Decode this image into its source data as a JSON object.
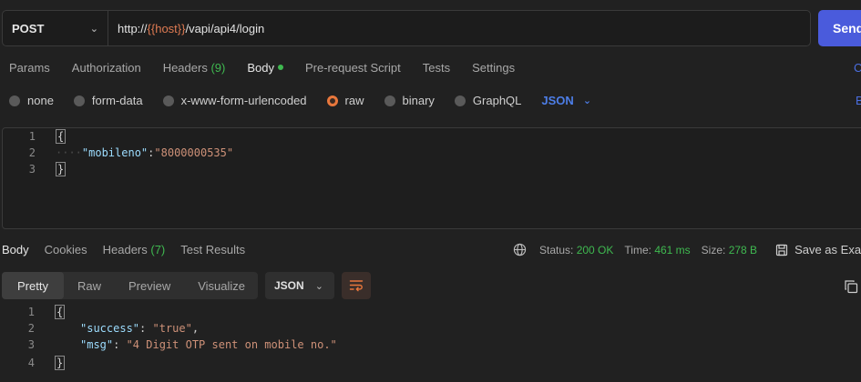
{
  "request": {
    "method": "POST",
    "url_prefix": "http://",
    "url_var": "{{host}}",
    "url_suffix": "/vapi/api4/login",
    "send_label": "Send"
  },
  "req_tabs": {
    "params": "Params",
    "authorization": "Authorization",
    "headers": "Headers",
    "headers_count": "(9)",
    "body": "Body",
    "prerequest": "Pre-request Script",
    "tests": "Tests",
    "settings": "Settings",
    "edge_c": "C",
    "edge_b": "B"
  },
  "body_types": {
    "none": "none",
    "form_data": "form-data",
    "urlencoded": "x-www-form-urlencoded",
    "raw": "raw",
    "binary": "binary",
    "graphql": "GraphQL",
    "language": "JSON"
  },
  "request_body": {
    "line_numbers": [
      "1",
      "2",
      "3"
    ],
    "open_brace": "{",
    "indent": "····",
    "key": "\"mobileno\"",
    "colon": ":",
    "value": "\"8000000535\"",
    "close_brace": "}"
  },
  "response": {
    "tabs": {
      "body": "Body",
      "cookies": "Cookies",
      "headers": "Headers",
      "headers_count": "(7)",
      "test_results": "Test Results"
    },
    "status_label": "Status:",
    "status_value": "200 OK",
    "time_label": "Time:",
    "time_value": "461 ms",
    "size_label": "Size:",
    "size_value": "278 B",
    "save_label": "Save as Exam",
    "view_tabs": {
      "pretty": "Pretty",
      "raw": "Raw",
      "preview": "Preview",
      "visualize": "Visualize"
    },
    "format": "JSON",
    "body": {
      "line_numbers": [
        "1",
        "2",
        "3",
        "4"
      ],
      "open_brace": "{",
      "key1": "\"success\"",
      "val1": "\"true\"",
      "key2": "\"msg\"",
      "val2": "\"4 Digit OTP sent on mobile no.\"",
      "close_brace": "}",
      "colon_sep": ": ",
      "comma": ","
    }
  },
  "colors": {
    "accent_orange": "#e8773c",
    "accent_green": "#3fb950",
    "send_blue": "#4a5bdc",
    "json_blue": "#4d7ee8",
    "key_color": "#9cdcfe",
    "string_color": "#ce9178"
  },
  "icons": {
    "method_dropdown": "chevron-down-icon",
    "language_dropdown": "chevron-down-icon",
    "globe": "globe-icon",
    "save": "save-icon",
    "wrap": "wrap-lines-icon",
    "copy": "copy-icon"
  }
}
